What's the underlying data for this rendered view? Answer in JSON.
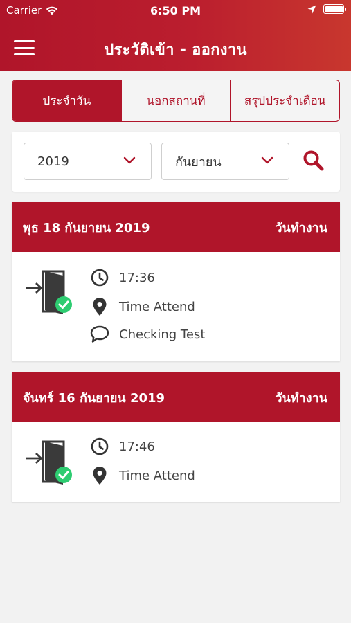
{
  "status_bar": {
    "carrier": "Carrier",
    "time": "6:50 PM"
  },
  "header": {
    "title": "ประวัติเข้า - ออกงาน",
    "menu_icon": "hamburger-menu-icon"
  },
  "tabs": [
    {
      "label": "ประจำวัน",
      "active": true
    },
    {
      "label": "นอกสถานที่",
      "active": false
    },
    {
      "label": "สรุปประจำเดือน",
      "active": false
    }
  ],
  "filter": {
    "year": "2019",
    "month": "กันยายน",
    "search_icon": "search-icon"
  },
  "days": [
    {
      "date": "พุธ 18 กันยายน 2019",
      "status": "วันทำงาน",
      "time": "17:36",
      "location": "Time Attend",
      "note": "Checking Test"
    },
    {
      "date": "จันทร์ 16 กันยายน 2019",
      "status": "วันทำงาน",
      "time": "17:46",
      "location": "Time Attend"
    }
  ],
  "colors": {
    "primary": "#b0152a",
    "check": "#2ecc71"
  }
}
